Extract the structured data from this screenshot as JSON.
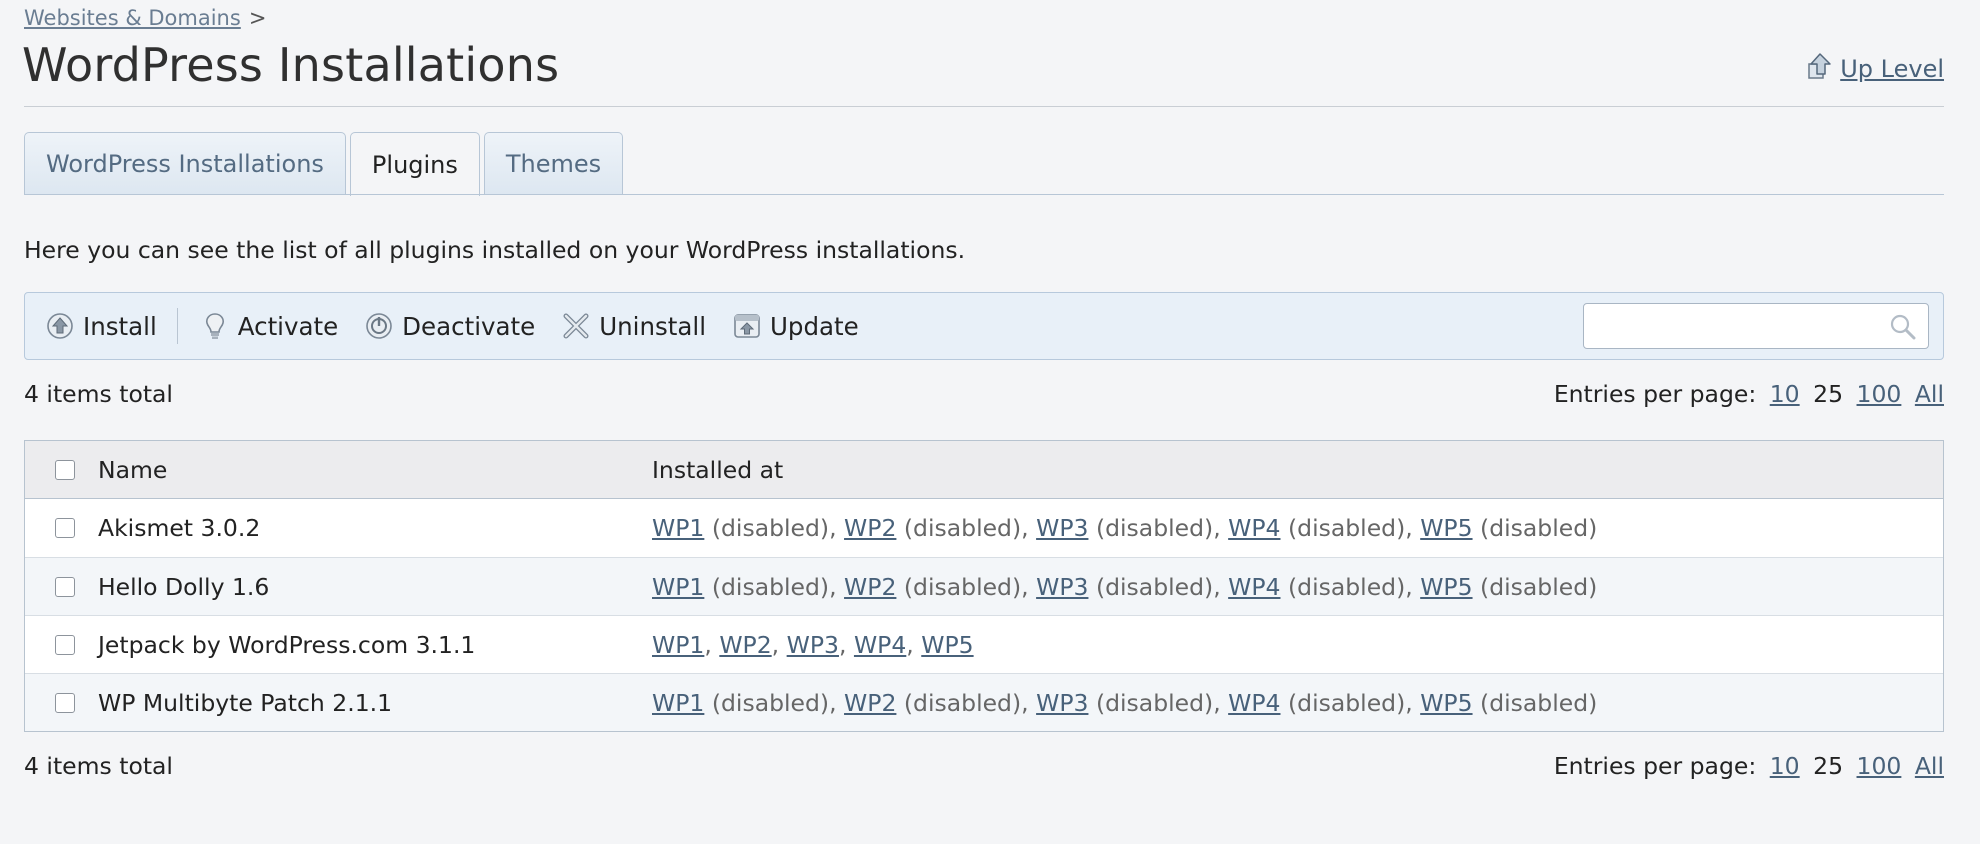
{
  "breadcrumb": {
    "parent": "Websites & Domains",
    "separator": ">"
  },
  "page_title": "WordPress Installations",
  "up_level": {
    "label": "Up Level",
    "icon": "up-level-icon"
  },
  "tabs": [
    {
      "label": "WordPress Installations",
      "active": false
    },
    {
      "label": "Plugins",
      "active": true
    },
    {
      "label": "Themes",
      "active": false
    }
  ],
  "description": "Here you can see the list of all plugins installed on your WordPress installations.",
  "toolbar": {
    "install": "Install",
    "activate": "Activate",
    "deactivate": "Deactivate",
    "uninstall": "Uninstall",
    "update": "Update",
    "search_value": ""
  },
  "summary": {
    "total": "4 items total",
    "entries_label": "Entries per page:",
    "options": [
      "10",
      "25",
      "100",
      "All"
    ],
    "selected": "25"
  },
  "table": {
    "headers": {
      "name": "Name",
      "installed_at": "Installed at"
    },
    "rows": [
      {
        "name": "Akismet 3.0.2",
        "installs": [
          {
            "site": "WP1",
            "status": "(disabled)"
          },
          {
            "site": "WP2",
            "status": "(disabled)"
          },
          {
            "site": "WP3",
            "status": "(disabled)"
          },
          {
            "site": "WP4",
            "status": "(disabled)"
          },
          {
            "site": "WP5",
            "status": "(disabled)"
          }
        ]
      },
      {
        "name": "Hello Dolly 1.6",
        "installs": [
          {
            "site": "WP1",
            "status": "(disabled)"
          },
          {
            "site": "WP2",
            "status": "(disabled)"
          },
          {
            "site": "WP3",
            "status": "(disabled)"
          },
          {
            "site": "WP4",
            "status": "(disabled)"
          },
          {
            "site": "WP5",
            "status": "(disabled)"
          }
        ]
      },
      {
        "name": "Jetpack by WordPress.com 3.1.1",
        "installs": [
          {
            "site": "WP1",
            "status": ""
          },
          {
            "site": "WP2",
            "status": ""
          },
          {
            "site": "WP3",
            "status": ""
          },
          {
            "site": "WP4",
            "status": ""
          },
          {
            "site": "WP5",
            "status": ""
          }
        ]
      },
      {
        "name": "WP Multibyte Patch 2.1.1",
        "installs": [
          {
            "site": "WP1",
            "status": "(disabled)"
          },
          {
            "site": "WP2",
            "status": "(disabled)"
          },
          {
            "site": "WP3",
            "status": "(disabled)"
          },
          {
            "site": "WP4",
            "status": "(disabled)"
          },
          {
            "site": "WP5",
            "status": "(disabled)"
          }
        ]
      }
    ]
  }
}
